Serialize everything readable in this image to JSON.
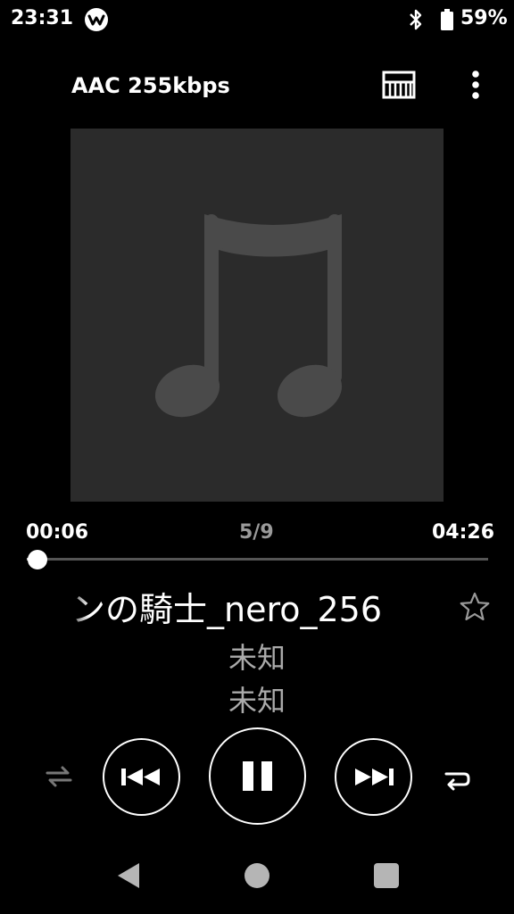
{
  "status_bar": {
    "time": "23:31",
    "battery_percent": "59%",
    "icons": [
      "walkman-logo-icon",
      "bluetooth-icon",
      "battery-icon"
    ]
  },
  "header": {
    "codec": "AAC 255kbps",
    "icons": [
      "equalizer-icon",
      "more-vert-icon"
    ]
  },
  "album_art": {
    "placeholder_icon": "music-note-icon",
    "background": "#2b2b2b",
    "note_color": "#4a4a4a"
  },
  "progress": {
    "elapsed": "00:06",
    "track_position": "5/9",
    "duration": "04:26",
    "fraction": 0.023
  },
  "track": {
    "title": "ンの騎士_nero_256",
    "artist": "未知",
    "album": "未知",
    "favorite": false
  },
  "controls": {
    "icons": [
      "shuffle-icon",
      "previous-icon",
      "pause-icon",
      "next-icon",
      "repeat-icon"
    ],
    "shuffle_active": false
  },
  "navigation": {
    "icons": [
      "back-icon",
      "home-icon",
      "recents-icon"
    ]
  }
}
